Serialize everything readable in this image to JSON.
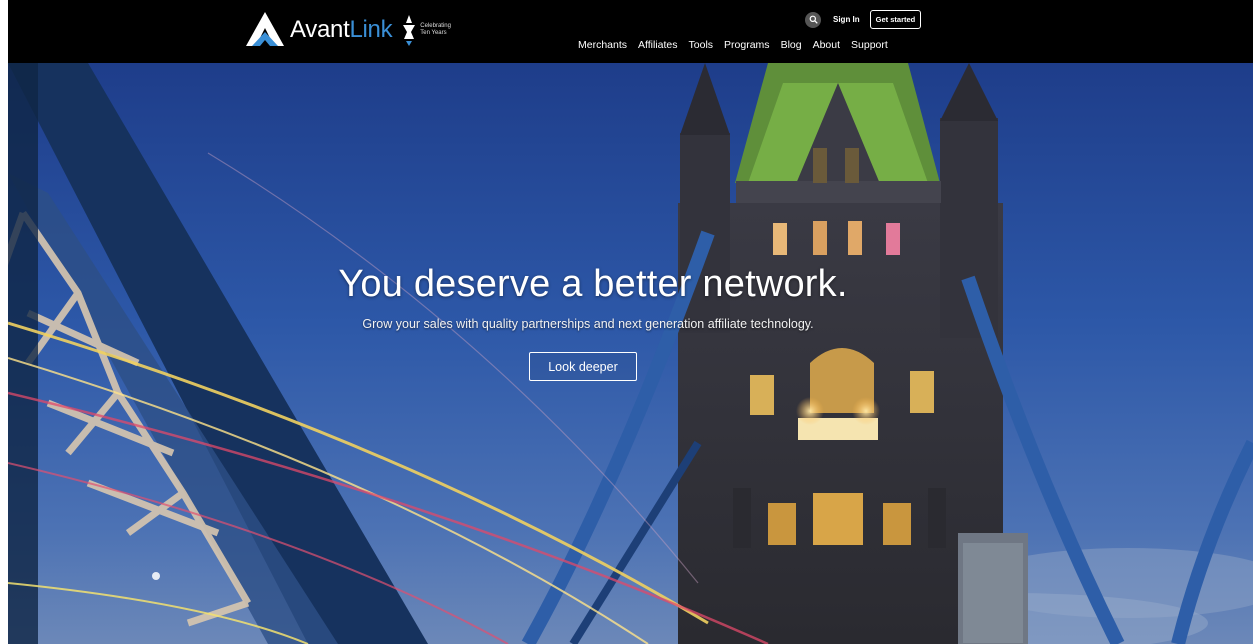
{
  "brand": {
    "name_part1": "Avant",
    "name_part2": "Link",
    "celebration_line1": "Celebrating",
    "celebration_line2": "Ten Years",
    "accent_color": "#3a8fd6"
  },
  "utility": {
    "search_icon": "search-icon",
    "sign_in": "Sign In",
    "get_started": "Get started"
  },
  "nav": {
    "items": [
      "Merchants",
      "Affiliates",
      "Tools",
      "Programs",
      "Blog",
      "About",
      "Support"
    ]
  },
  "hero": {
    "headline": "You deserve a better network.",
    "subheadline": "Grow your sales with quality partnerships and next generation affiliate technology.",
    "cta": "Look deeper"
  }
}
